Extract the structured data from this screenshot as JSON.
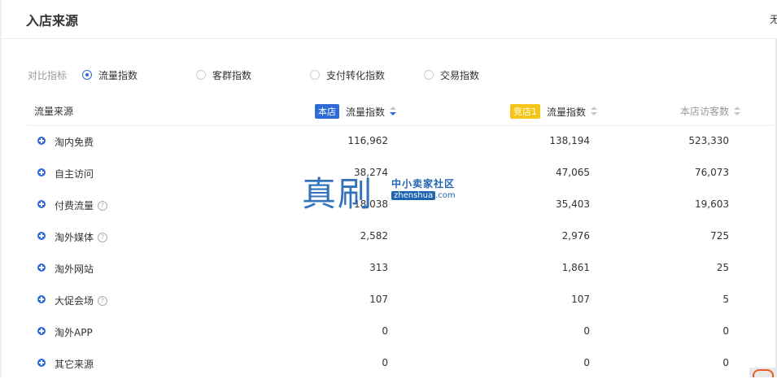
{
  "header": {
    "title": "入店来源",
    "top_right_text": "无"
  },
  "filter": {
    "label": "对比指标",
    "options": [
      {
        "label": "流量指数",
        "checked": true
      },
      {
        "label": "客群指数",
        "checked": false
      },
      {
        "label": "支付转化指数",
        "checked": false
      },
      {
        "label": "交易指数",
        "checked": false
      }
    ]
  },
  "table": {
    "headers": {
      "source": "流量来源",
      "own_tag": "本店",
      "own_metric": "流量指数",
      "comp_tag": "竞店1",
      "comp_metric": "流量指数",
      "visitors": "本店访客数"
    },
    "rows": [
      {
        "label": "淘内免费",
        "help": false,
        "own": "116,962",
        "comp": "138,194",
        "visitors": "523,330"
      },
      {
        "label": "自主访问",
        "help": false,
        "own": "38,274",
        "comp": "47,065",
        "visitors": "76,073"
      },
      {
        "label": "付费流量",
        "help": true,
        "own": "18,038",
        "comp": "35,403",
        "visitors": "19,603"
      },
      {
        "label": "淘外媒体",
        "help": true,
        "own": "2,582",
        "comp": "2,976",
        "visitors": "725"
      },
      {
        "label": "淘外网站",
        "help": false,
        "own": "313",
        "comp": "1,861",
        "visitors": "25"
      },
      {
        "label": "大促会场",
        "help": true,
        "own": "107",
        "comp": "107",
        "visitors": "5"
      },
      {
        "label": "淘外APP",
        "help": false,
        "own": "0",
        "comp": "0",
        "visitors": "0"
      },
      {
        "label": "其它来源",
        "help": false,
        "own": "0",
        "comp": "0",
        "visitors": "0"
      }
    ]
  },
  "watermark": {
    "big": "真刷",
    "cn": "中小卖家社区",
    "en_name": "zhenshua",
    "en_suffix": ".com"
  },
  "colors": {
    "accent": "#2f6bd6",
    "competitor": "#f5c518",
    "watermark": "#1e64b4"
  }
}
